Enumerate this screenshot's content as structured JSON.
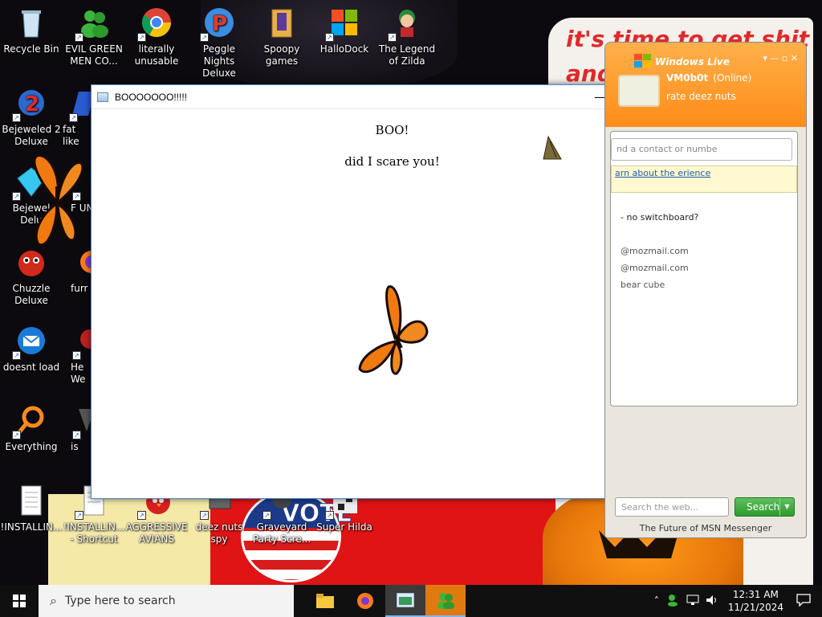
{
  "desktop": {
    "wallpaper_text": [
      "it's time to get shit",
      "and"
    ],
    "vote_text": "VOTE",
    "icons": [
      {
        "label": "Recycle Bin"
      },
      {
        "label": "EVIL GREEN MEN CO..."
      },
      {
        "label": "literally unusable"
      },
      {
        "label": "Peggle Nights Deluxe"
      },
      {
        "label": "Spoopy games"
      },
      {
        "label": "HalloDock"
      },
      {
        "label": "The Legend of Zilda"
      },
      {
        "label": "Bejeweled 2 Deluxe"
      },
      {
        "label": "fat like"
      },
      {
        "label": "Bejewel Delu"
      },
      {
        "label": "F UN"
      },
      {
        "label": "Chuzzle Deluxe"
      },
      {
        "label": "furr"
      },
      {
        "label": "doesnt load"
      },
      {
        "label": "He We"
      },
      {
        "label": "Everything"
      },
      {
        "label": "is"
      },
      {
        "label": "!INSTALLIN..."
      },
      {
        "label": "!INSTALLIN... - Shortcut"
      },
      {
        "label": "AGGRESSIVE AVIANS"
      },
      {
        "label": "deez nuts spy"
      },
      {
        "label": "Graveyard Party Scre..."
      },
      {
        "label": "Super Hilda"
      }
    ]
  },
  "popup": {
    "title": "BOOOOOOO!!!!!",
    "heading": "BOO!",
    "message": "did I scare you!"
  },
  "msn": {
    "brand": "Windows Live",
    "username": "VM0b0t",
    "status": "(Online)",
    "personal_message": "rate deez nuts",
    "contact_search_placeholder": "nd a contact or numbe",
    "info_link": "arn about the erience",
    "contacts": [
      "- no switchboard?",
      "@mozmail.com",
      "@mozmail.com",
      "bear cube"
    ],
    "web_search_placeholder": "Search the web...",
    "search_button": "Search",
    "footer": "The Future of MSN Messenger"
  },
  "taskbar": {
    "search_placeholder": "Type here to search",
    "time": "12:31 AM",
    "date": "11/21/2024"
  },
  "colors": {
    "msn_orange": "#ff9a2c",
    "taskbar": "#101010",
    "accent_blue": "#4f8ad1"
  }
}
